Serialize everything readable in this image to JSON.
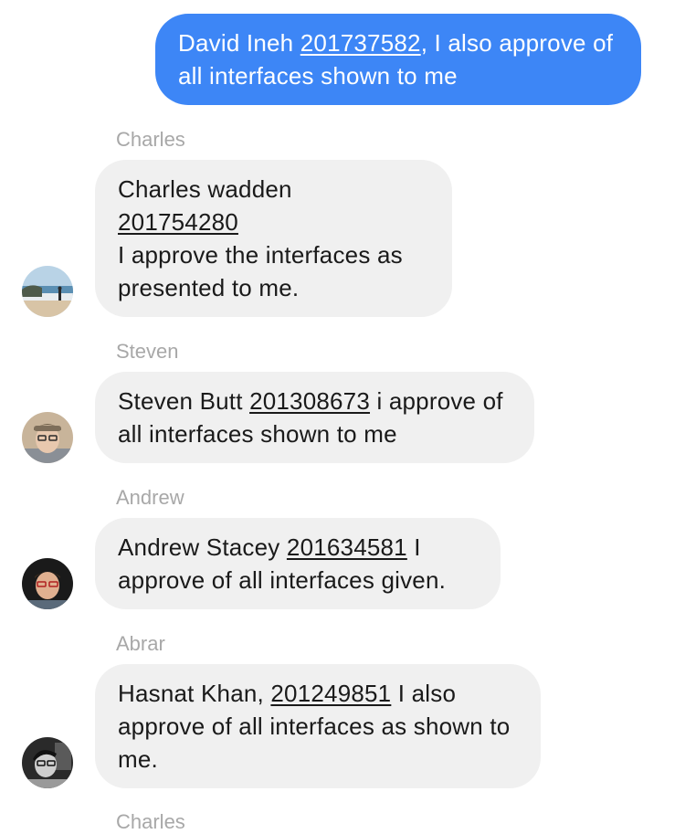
{
  "messages": {
    "outgoing": {
      "name": "David Ineh",
      "id": "201737582",
      "text": ", I also approve of all interfaces shown to me"
    },
    "charles": {
      "sender": "Charles",
      "line1": "Charles wadden",
      "id": "201754280",
      "text": "I approve the interfaces as presented to me."
    },
    "steven": {
      "sender": "Steven",
      "name": "Steven Butt",
      "id": "201308673",
      "text": "i approve of all interfaces shown to me"
    },
    "andrew": {
      "sender": "Andrew",
      "name": "Andrew Stacey",
      "id": "201634581",
      "text": "I approve of all interfaces given."
    },
    "abrar": {
      "sender": "Abrar",
      "name": "Hasnat Khan,",
      "id": "201249851",
      "text": "I also approve of all interfaces as shown to me."
    },
    "next_sender": "Charles"
  },
  "colors": {
    "outgoing_bubble": "#3d86f6",
    "incoming_bubble": "#f0f0f0",
    "sender_label": "#a8a8a8"
  }
}
